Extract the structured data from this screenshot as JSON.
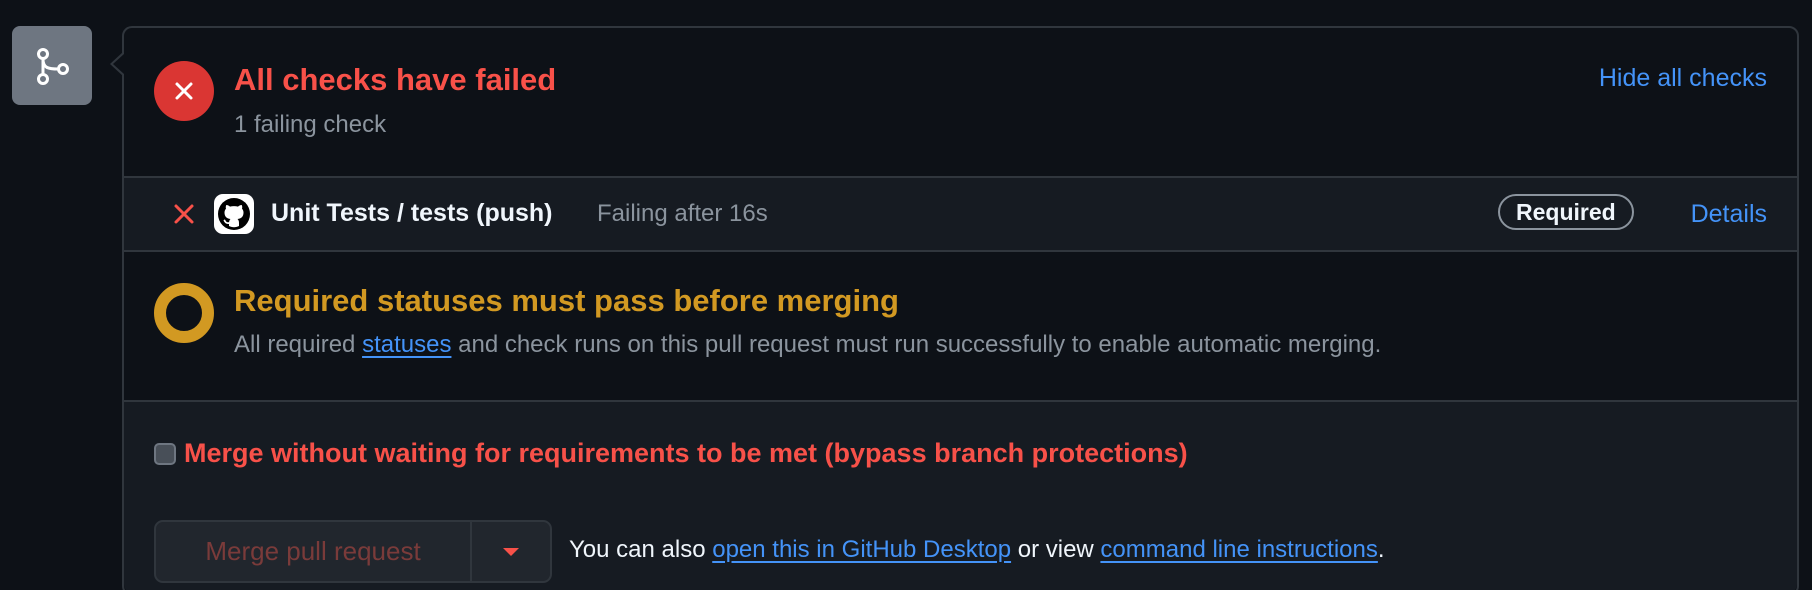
{
  "header": {
    "title": "All checks have failed",
    "subtitle": "1 failing check",
    "hide_link": "Hide all checks"
  },
  "check": {
    "name": "Unit Tests / tests (push)",
    "status": "Failing after 16s",
    "badge": "Required",
    "details_link": "Details"
  },
  "status_section": {
    "title": "Required statuses must pass before merging",
    "desc_before": "All required ",
    "desc_link": "statuses",
    "desc_after": " and check runs on this pull request must run successfully to enable automatic merging."
  },
  "merge": {
    "bypass_label": "Merge without waiting for requirements to be met (bypass branch protections)",
    "bypass_checked": false,
    "button_label": "Merge pull request",
    "help_prefix": "You can also ",
    "help_link_desktop": "open this in GitHub Desktop",
    "help_middle": " or view ",
    "help_link_cli": "command line instructions",
    "help_suffix": "."
  },
  "icons": {
    "branch": "git-merge-icon",
    "fail": "x-circle-icon",
    "check_fail": "x-icon",
    "github": "github-logo-icon",
    "pending": "pending-ring-icon",
    "dropdown": "triangle-down-icon"
  },
  "colors": {
    "background": "#0d1117",
    "danger": "#f85149",
    "danger_fill": "#da3633",
    "warning": "#d29922",
    "link": "#4493f8",
    "muted": "#8b949e",
    "border": "#30363d"
  }
}
